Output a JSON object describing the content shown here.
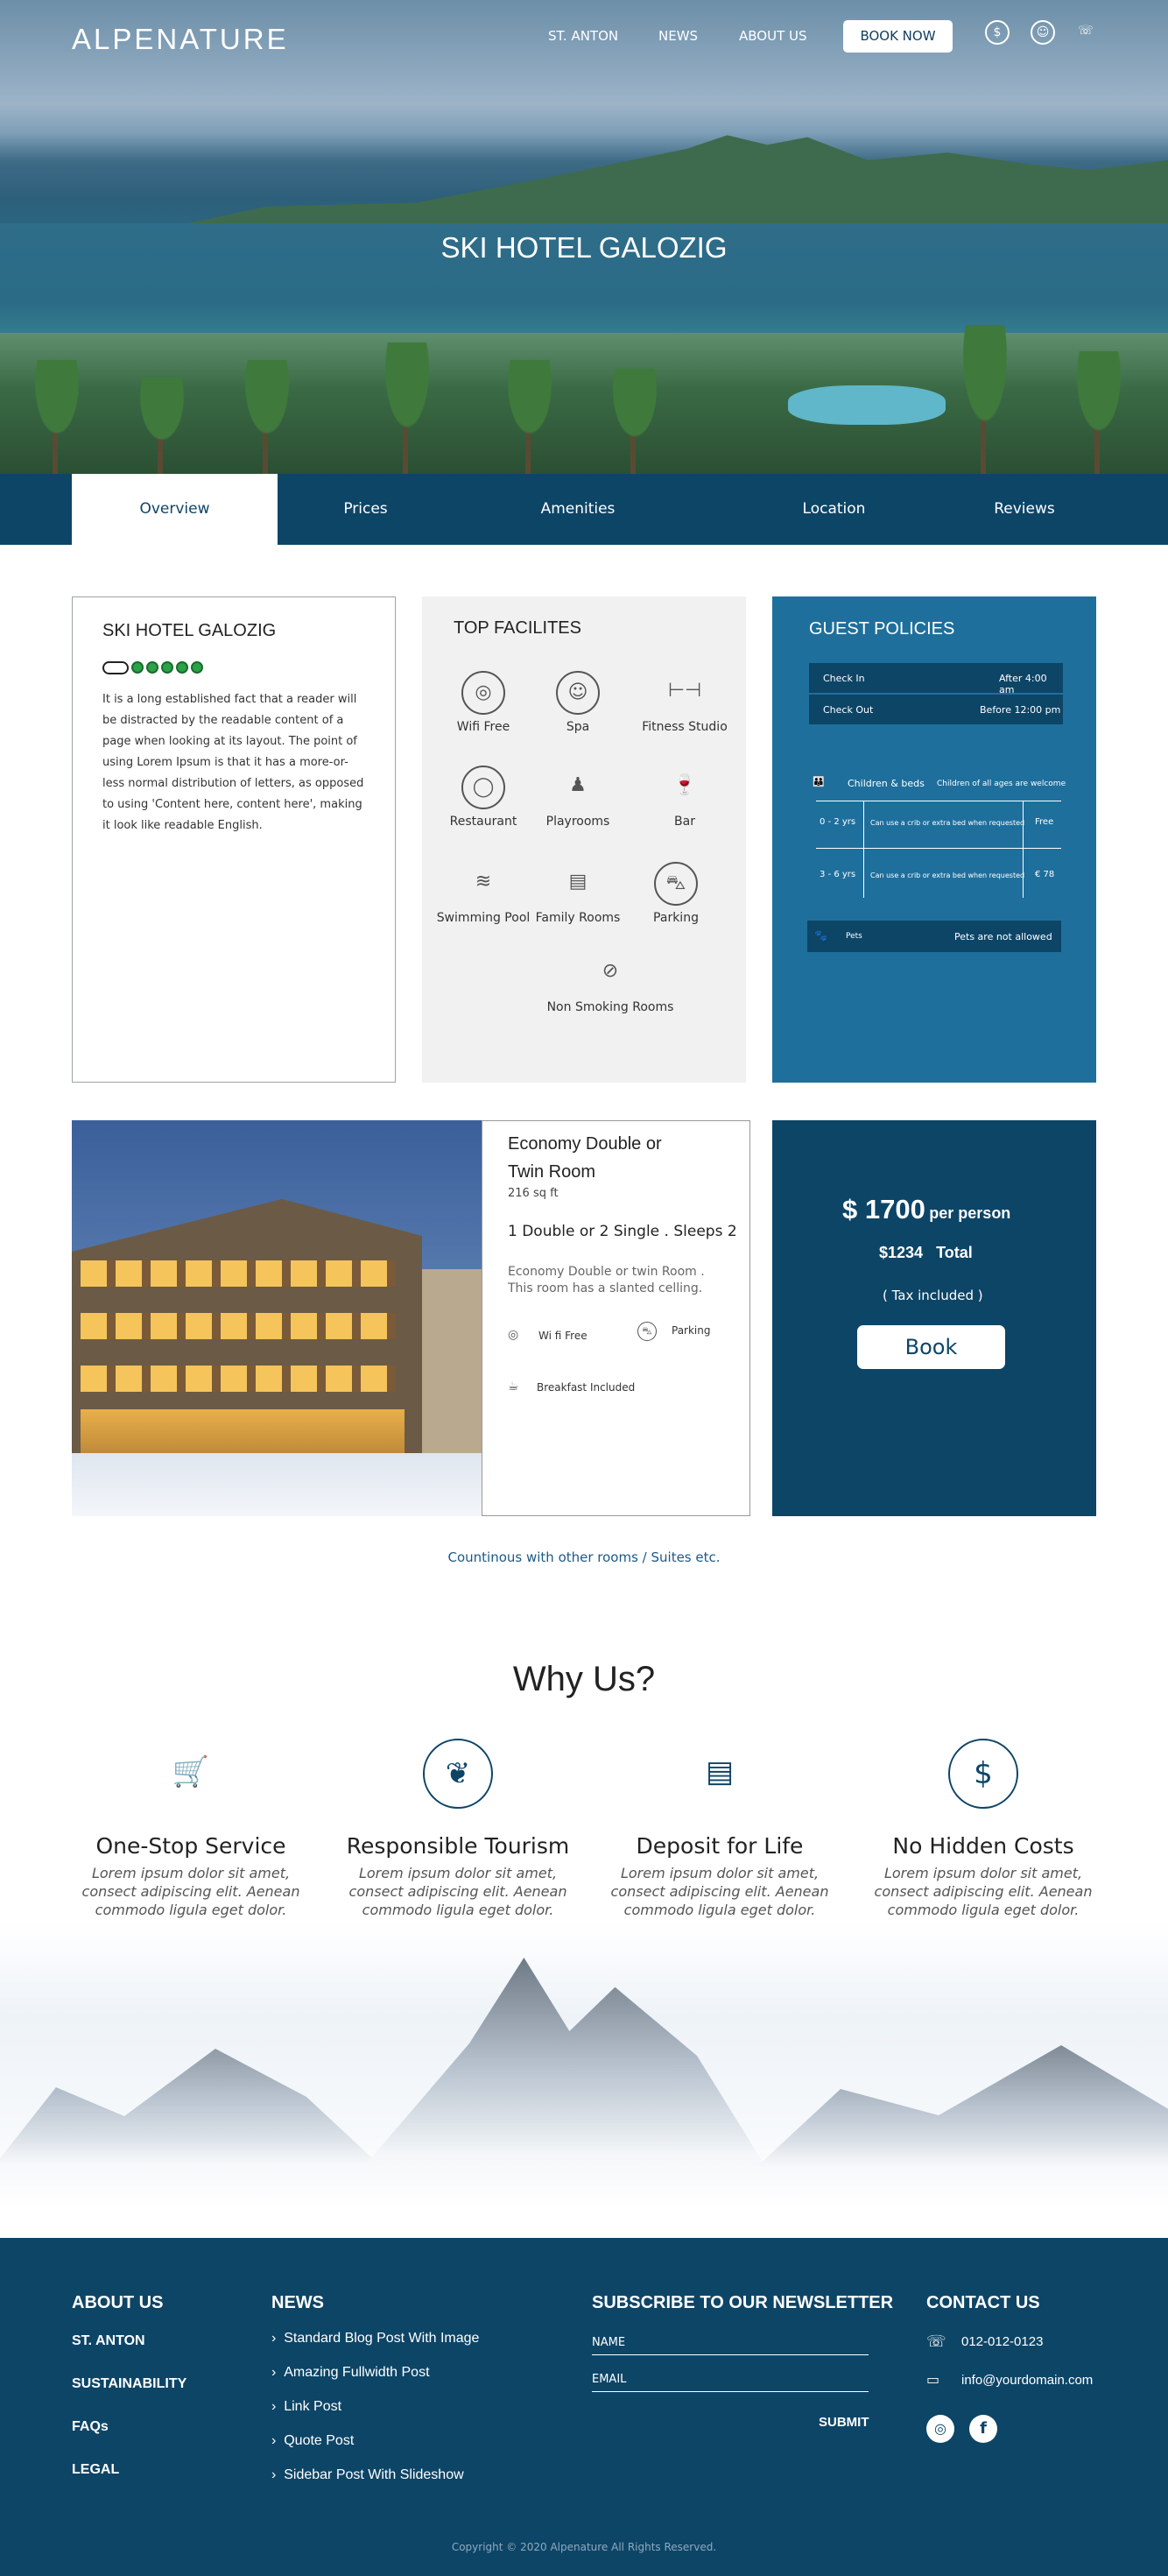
{
  "header": {
    "logo": "ALPENATURE",
    "nav": [
      "ST. ANTON",
      "NEWS",
      "ABOUT US"
    ],
    "book_now": "BOOK NOW",
    "icons": [
      "currency-exchange-icon",
      "user-icon",
      "phone-icon"
    ]
  },
  "hero": {
    "title": "SKI HOTEL GALOZIG"
  },
  "tabs": [
    "Overview",
    "Prices",
    "Amenities",
    "Location",
    "Reviews"
  ],
  "about": {
    "title": "SKI HOTEL GALOZIG",
    "rating": 5,
    "text": "It is a long established fact that a reader will be distracted by the readable content of a page when looking at its layout. The point of using Lorem Ipsum is that it has a more-or-less normal distribution of letters, as opposed to using 'Content here, content here', making it look like readable English."
  },
  "facilities": {
    "title": "TOP FACILITES",
    "items": [
      {
        "label": "Wifi Free",
        "icon": "wifi-icon"
      },
      {
        "label": "Spa",
        "icon": "spa-icon"
      },
      {
        "label": "Fitness Studio",
        "icon": "dumbbell-icon"
      },
      {
        "label": "Restaurant",
        "icon": "plate-icon"
      },
      {
        "label": "Playrooms",
        "icon": "toys-icon"
      },
      {
        "label": "Bar",
        "icon": "bar-icon"
      },
      {
        "label": "Swimming Pool",
        "icon": "pool-icon"
      },
      {
        "label": "Family Rooms",
        "icon": "family-room-icon"
      },
      {
        "label": "Parking",
        "icon": "car-icon"
      },
      {
        "label": "Non Smoking Rooms",
        "icon": "no-smoking-icon"
      }
    ]
  },
  "policies": {
    "title": "GUEST POLICIES",
    "check_in_label": "Check In",
    "check_in_value": "After 4:00 am",
    "check_out_label": "Check Out",
    "check_out_value": "Before 12:00 pm",
    "children_label": "Children & beds",
    "children_note": "Children of all ages are welcome",
    "rows": [
      {
        "age": "0 - 2 yrs",
        "note": "Can use a crib or extra bed when requested",
        "price": "Free"
      },
      {
        "age": "3 - 6 yrs",
        "note": "Can use a crib or extra bed when requested",
        "price": "€ 78"
      }
    ],
    "pets_label": "Pets",
    "pets_value": "Pets are not  allowed"
  },
  "room": {
    "title_line1": "Economy Double  or",
    "title_line2": "Twin Room",
    "size": "216 sq ft",
    "beds": "1 Double or 2 Single . Sleeps 2",
    "desc": "Economy Double or twin Room . This room has a slanted celling.",
    "wifi": "Wi fi  Free",
    "parking": "Parking",
    "breakfast": "Breakfast Included"
  },
  "price": {
    "main": "$ 1700",
    "per": "per person",
    "total_value": "$1234",
    "total_label": "Total",
    "tax": "( Tax included )",
    "book": "Book"
  },
  "continue_note": "Countinous with other rooms / Suites etc.",
  "why": {
    "title": "Why Us?",
    "items": [
      {
        "title": "One-Stop Service",
        "icon": "cart-icon",
        "text": "Lorem ipsum dolor sit amet, consect adipiscing elit. Aenean commodo ligula eget dolor. Aenean massa"
      },
      {
        "title": "Responsible Tourism",
        "icon": "hand-leaf-icon",
        "text": "Lorem ipsum dolor sit amet, consect adipiscing elit. Aenean commodo ligula eget dolor. Aenean massa"
      },
      {
        "title": "Deposit for Life",
        "icon": "money-stack-icon",
        "text": "Lorem ipsum dolor sit amet, consect adipiscing elit. Aenean commodo ligula eget dolor. Aenean massa"
      },
      {
        "title": "No Hidden Costs",
        "icon": "dollar-circle-icon",
        "text": "Lorem ipsum dolor sit amet, consect adipiscing elit. Aenean commodo ligula eget dolor. Aenean massa"
      }
    ]
  },
  "footer": {
    "about_title": "ABOUT US",
    "about_links": [
      "ST. ANTON",
      "SUSTAINABILITY",
      "FAQs",
      "LEGAL"
    ],
    "news_title": "NEWS",
    "news_links": [
      "Standard Blog Post With Image",
      "Amazing Fullwidth Post",
      "Link Post",
      "Quote Post",
      "Sidebar Post With Slideshow"
    ],
    "newsletter_title": "SUBSCRIBE TO OUR NEWSLETTER",
    "name_placeholder": "NAME",
    "email_placeholder": "EMAIL",
    "submit": "SUBMIT",
    "contact_title": "CONTACT US",
    "phone": "012-012-0123",
    "email": "info@yourdomain.com",
    "copyright": "Copyright © 2020  Alpenature  All Rights Reserved."
  }
}
